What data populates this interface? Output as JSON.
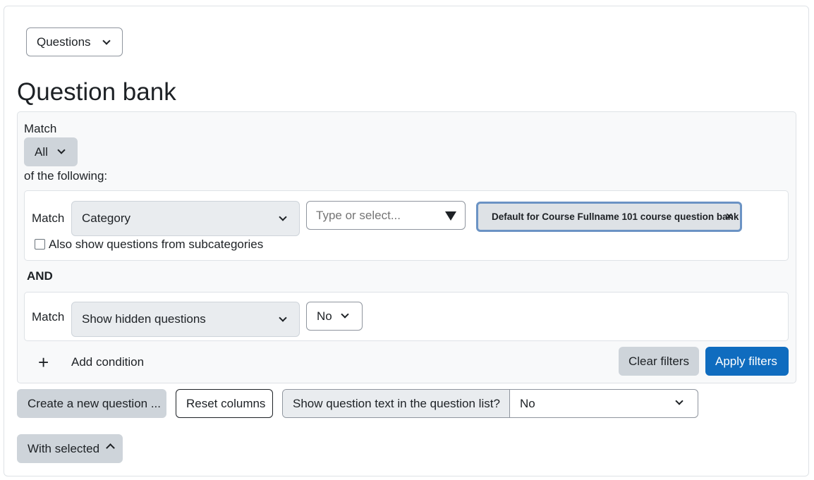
{
  "top_dropdown": {
    "label": "Questions"
  },
  "page_title": "Question bank",
  "filter": {
    "match_label": "Match",
    "match_mode": "All",
    "of_following": "of the following:",
    "conditions": [
      {
        "match_label": "Match",
        "type": "Category",
        "input_placeholder": "Type or select...",
        "selected_tag": "Default for Course Fullname 101 course question bank",
        "tag_remove": "×",
        "checkbox_label": "Also show questions from subcategories",
        "checkbox_checked": false
      },
      {
        "match_label": "Match",
        "type": "Show hidden questions",
        "value": "No"
      }
    ],
    "joiner": "AND",
    "add_condition_icon": "+",
    "add_condition": "Add condition",
    "clear_button": "Clear filters",
    "apply_button": "Apply filters"
  },
  "actions": {
    "create_button": "Create a new question ...",
    "reset_columns": "Reset columns",
    "show_text_label": "Show question text in the question list?",
    "show_text_value": "No",
    "with_selected": "With selected"
  },
  "colors": {
    "primary": "#0f6cbf",
    "secondary": "#ced4da",
    "tag_border": "#6b93c4"
  }
}
